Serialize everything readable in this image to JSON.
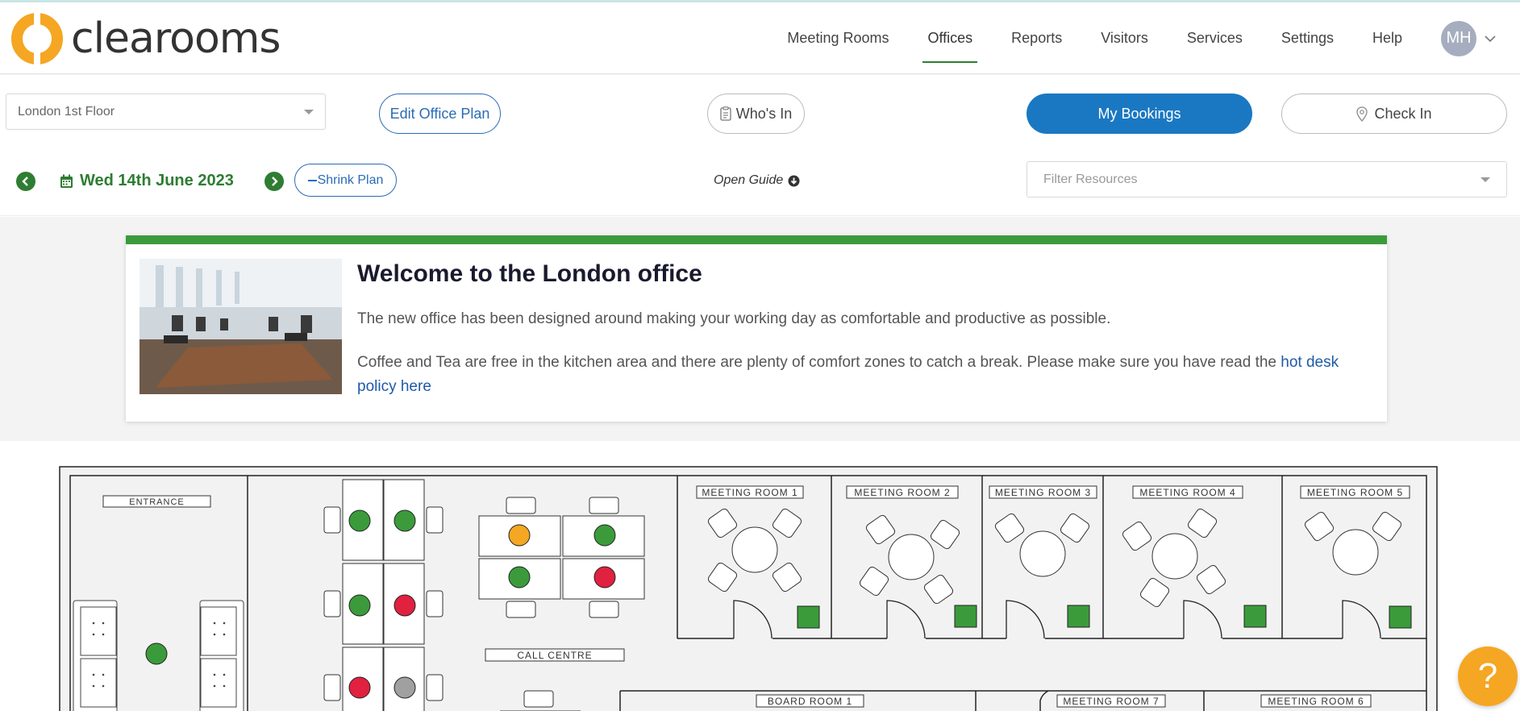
{
  "app": {
    "name": "clearooms"
  },
  "nav": {
    "items": [
      {
        "label": "Meeting Rooms"
      },
      {
        "label": "Offices",
        "active": true
      },
      {
        "label": "Reports"
      },
      {
        "label": "Visitors"
      },
      {
        "label": "Services"
      },
      {
        "label": "Settings"
      },
      {
        "label": "Help"
      }
    ],
    "user_initials": "MH"
  },
  "toolbar": {
    "location": "London 1st Floor",
    "edit_plan_label": "Edit Office Plan",
    "whos_in_label": "Who's In",
    "my_bookings_label": "My Bookings",
    "check_in_label": "Check In",
    "date": "Wed 14th June 2023",
    "shrink_label": "Shrink Plan",
    "open_guide_label": "Open Guide",
    "filter_placeholder": "Filter Resources"
  },
  "welcome": {
    "title": "Welcome to the London office",
    "p1": "The new office has been designed around making your working day as comfortable and productive as possible.",
    "p2": "Coffee and Tea are free in the kitchen area and there are plenty of comfort zones to catch a break. Please make sure you have read the ",
    "link": "hot desk policy here"
  },
  "plan": {
    "labels": {
      "entrance": "ENTRANCE",
      "call_centre": "CALL CENTRE",
      "mr1": "MEETING ROOM 1",
      "mr2": "MEETING ROOM 2",
      "mr3": "MEETING ROOM 3",
      "mr4": "MEETING ROOM 4",
      "mr5": "MEETING ROOM 5",
      "br1": "BOARD ROOM 1",
      "mr7": "MEETING ROOM 7",
      "mr6": "MEETING ROOM 6"
    },
    "status_colors": {
      "available": "#3b9b3b",
      "booked": "#e0213f",
      "pending": "#f5a623",
      "unavailable": "#a0a0a0"
    }
  },
  "help": {
    "label": "?"
  }
}
